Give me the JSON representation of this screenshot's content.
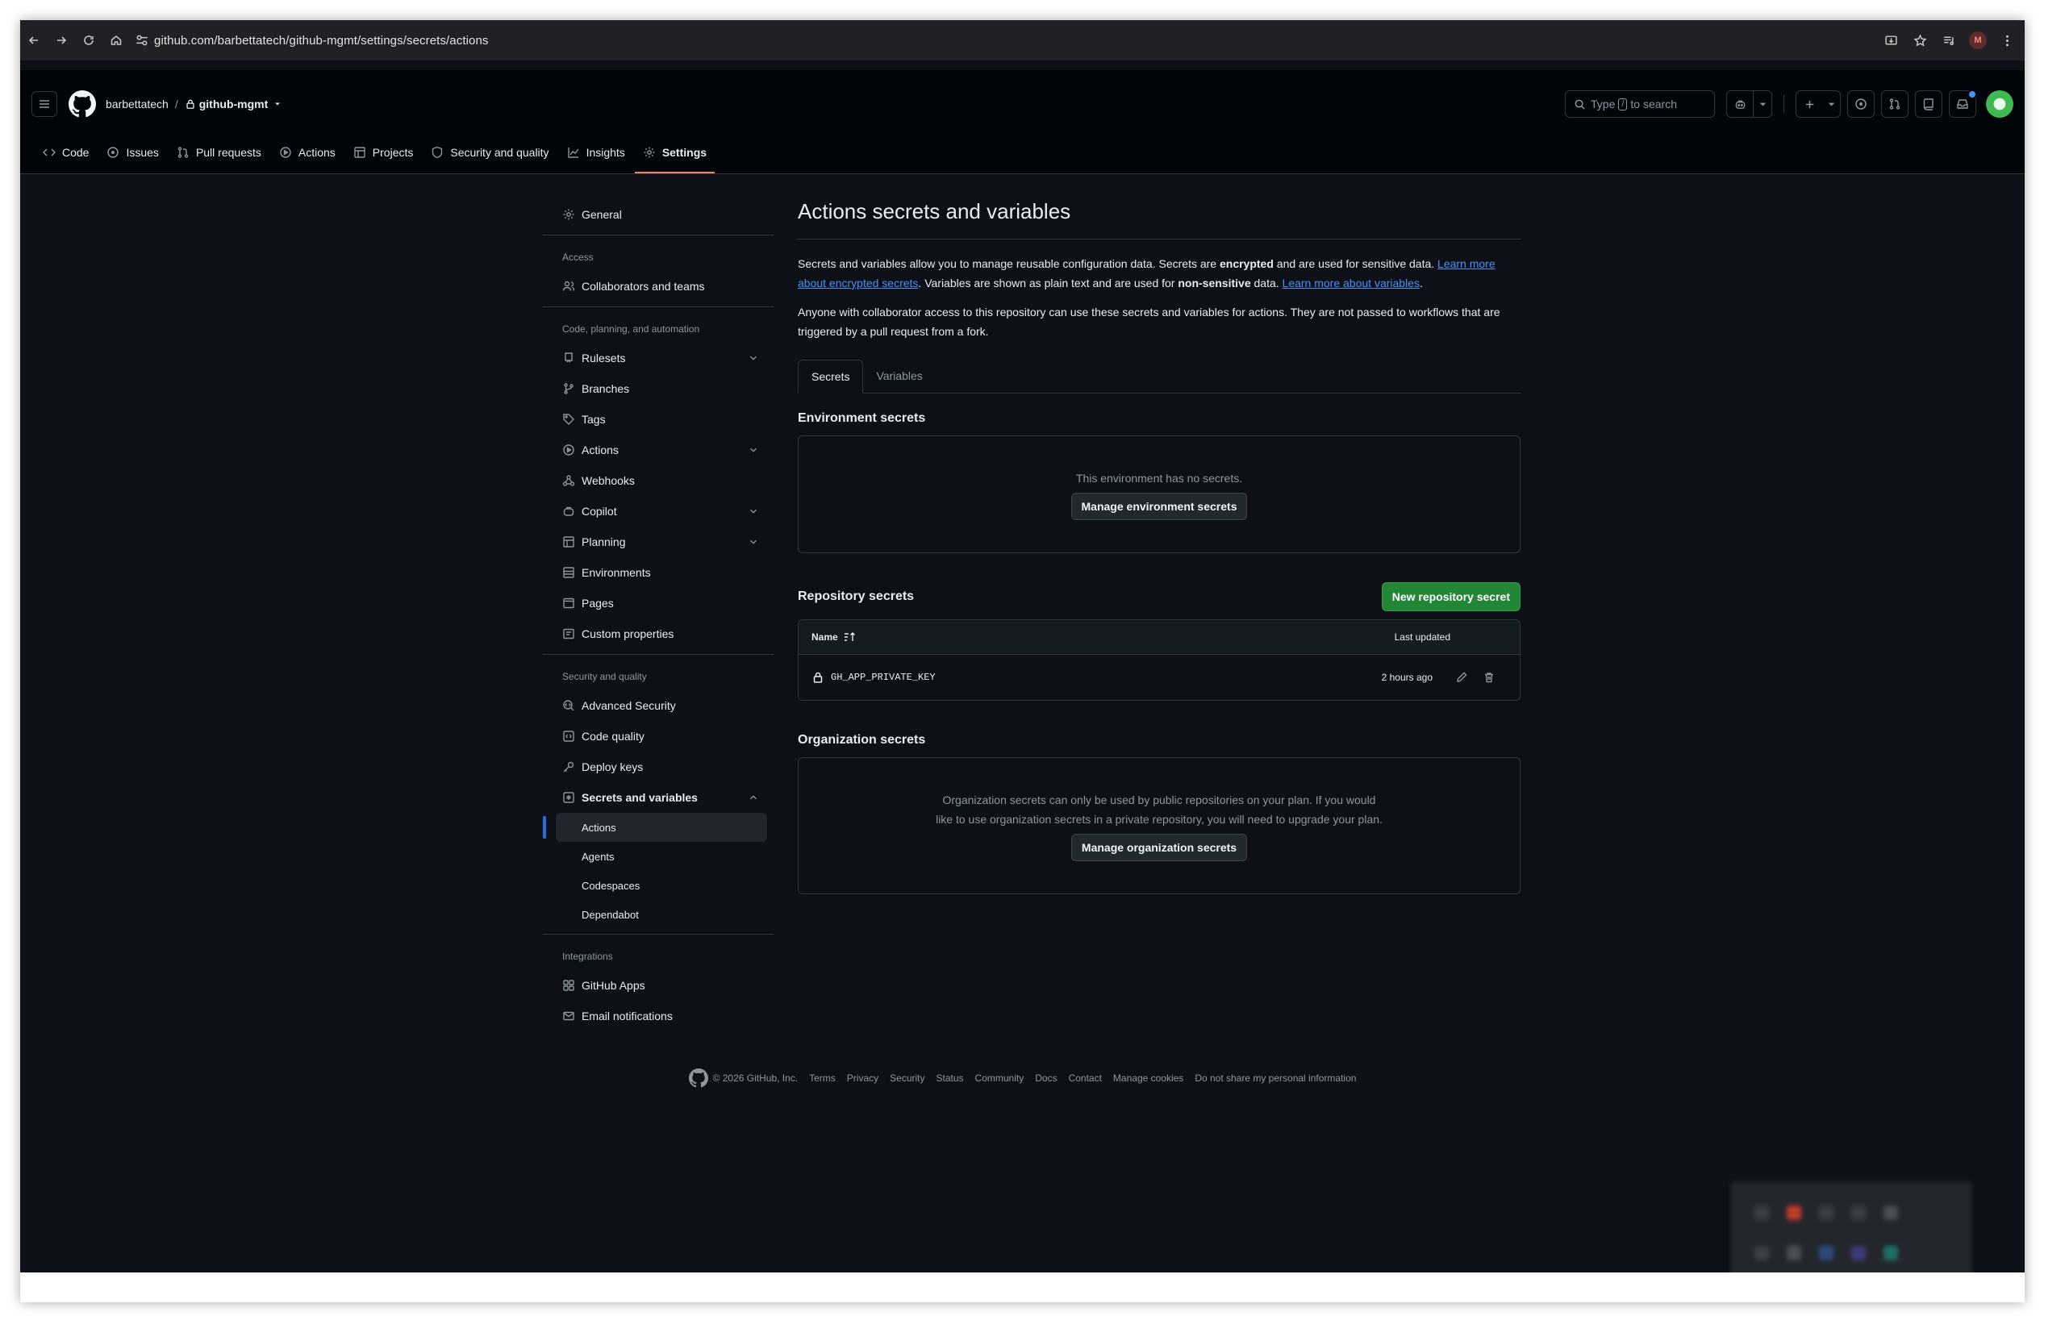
{
  "browser": {
    "url": "github.com/barbettatech/github-mgmt/settings/secrets/actions",
    "profile_initial": "M"
  },
  "header": {
    "owner": "barbettatech",
    "separator": "/",
    "repo": "github-mgmt",
    "search_prefix": "Type",
    "search_key": "/",
    "search_suffix": "to search"
  },
  "repo_tabs": [
    {
      "label": "Code",
      "icon": "code-icon"
    },
    {
      "label": "Issues",
      "icon": "issue-icon"
    },
    {
      "label": "Pull requests",
      "icon": "pull-request-icon"
    },
    {
      "label": "Actions",
      "icon": "play-icon"
    },
    {
      "label": "Projects",
      "icon": "table-icon"
    },
    {
      "label": "Security and quality",
      "icon": "shield-icon"
    },
    {
      "label": "Insights",
      "icon": "graph-icon"
    },
    {
      "label": "Settings",
      "icon": "gear-icon",
      "active": true
    }
  ],
  "sidebar": {
    "general": "General",
    "access_heading": "Access",
    "collaborators": "Collaborators and teams",
    "code_heading": "Code, planning, and automation",
    "rulesets": "Rulesets",
    "branches": "Branches",
    "tags": "Tags",
    "actions": "Actions",
    "webhooks": "Webhooks",
    "copilot": "Copilot",
    "planning": "Planning",
    "environments": "Environments",
    "pages": "Pages",
    "custom_properties": "Custom properties",
    "security_heading": "Security and quality",
    "advanced_security": "Advanced Security",
    "code_quality": "Code quality",
    "deploy_keys": "Deploy keys",
    "secrets_and_variables": "Secrets and variables",
    "sub_actions": "Actions",
    "sub_agents": "Agents",
    "sub_codespaces": "Codespaces",
    "sub_dependabot": "Dependabot",
    "integrations_heading": "Integrations",
    "github_apps": "GitHub Apps",
    "email_notifications": "Email notifications"
  },
  "main": {
    "title": "Actions secrets and variables",
    "p1_a": "Secrets and variables allow you to manage reusable configuration data. Secrets are ",
    "p1_b": "encrypted",
    "p1_c": " and are used for sensitive data. ",
    "p1_link1": "Learn more about encrypted secrets",
    "p1_d": ". Variables are shown as plain text and are used for ",
    "p1_e": "non-sensitive",
    "p1_f": " data. ",
    "p1_link2": "Learn more about variables",
    "p1_g": ".",
    "p2": "Anyone with collaborator access to this repository can use these secrets and variables for actions. They are not passed to workflows that are triggered by a pull request from a fork.",
    "tab_secrets": "Secrets",
    "tab_variables": "Variables",
    "env_title": "Environment secrets",
    "env_empty": "This environment has no secrets.",
    "env_button": "Manage environment secrets",
    "repo_title": "Repository secrets",
    "repo_button": "New repository secret",
    "col_name": "Name",
    "col_updated": "Last updated",
    "secrets": [
      {
        "name": "GH_APP_PRIVATE_KEY",
        "updated": "2 hours ago"
      }
    ],
    "org_title": "Organization secrets",
    "org_empty_1": "Organization secrets can only be used by public repositories on your plan. If you would",
    "org_empty_2": "like to use organization secrets in a private repository, you will need to upgrade your plan.",
    "org_button": "Manage organization secrets"
  },
  "footer": {
    "copyright": "© 2026 GitHub, Inc.",
    "links": [
      "Terms",
      "Privacy",
      "Security",
      "Status",
      "Community",
      "Docs",
      "Contact",
      "Manage cookies",
      "Do not share my personal information"
    ]
  },
  "colors": {
    "background": "#0d1117",
    "header": "#010409",
    "accent_tab": "#f78166",
    "link": "#4493f8",
    "primary_button": "#238636",
    "active_indicator": "#1f6feb"
  }
}
